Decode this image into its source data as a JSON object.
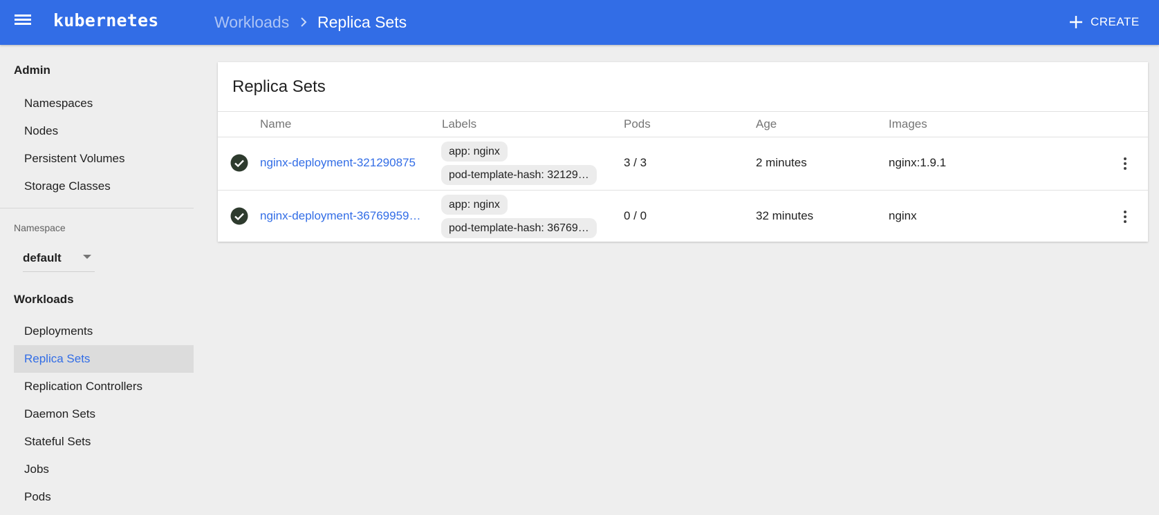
{
  "header": {
    "brand": "kubernetes",
    "breadcrumb_parent": "Workloads",
    "breadcrumb_current": "Replica Sets",
    "create_label": "CREATE"
  },
  "sidebar": {
    "admin_heading": "Admin",
    "admin_items": [
      "Namespaces",
      "Nodes",
      "Persistent Volumes",
      "Storage Classes"
    ],
    "namespace_label": "Namespace",
    "namespace_value": "default",
    "workloads_heading": "Workloads",
    "workload_items": [
      "Deployments",
      "Replica Sets",
      "Replication Controllers",
      "Daemon Sets",
      "Stateful Sets",
      "Jobs",
      "Pods"
    ],
    "active_item": "Replica Sets"
  },
  "card": {
    "title": "Replica Sets",
    "columns": [
      "Name",
      "Labels",
      "Pods",
      "Age",
      "Images"
    ],
    "rows": [
      {
        "name": "nginx-deployment-321290875",
        "labels": [
          "app: nginx",
          "pod-template-hash: 32129…"
        ],
        "pods": "3 / 3",
        "age": "2 minutes",
        "images": "nginx:1.9.1"
      },
      {
        "name": "nginx-deployment-36769959…",
        "labels": [
          "app: nginx",
          "pod-template-hash: 36769…"
        ],
        "pods": "0 / 0",
        "age": "32 minutes",
        "images": "nginx"
      }
    ]
  },
  "icons": {
    "menu": "menu-icon",
    "chevron": "chevron-right-icon",
    "plus": "plus-icon",
    "status": "check-circle-icon",
    "actions": "more-vert-icon"
  },
  "colors": {
    "brand": "#326de6",
    "status_ok": "#2e3b2e",
    "background": "#eeeeee"
  }
}
